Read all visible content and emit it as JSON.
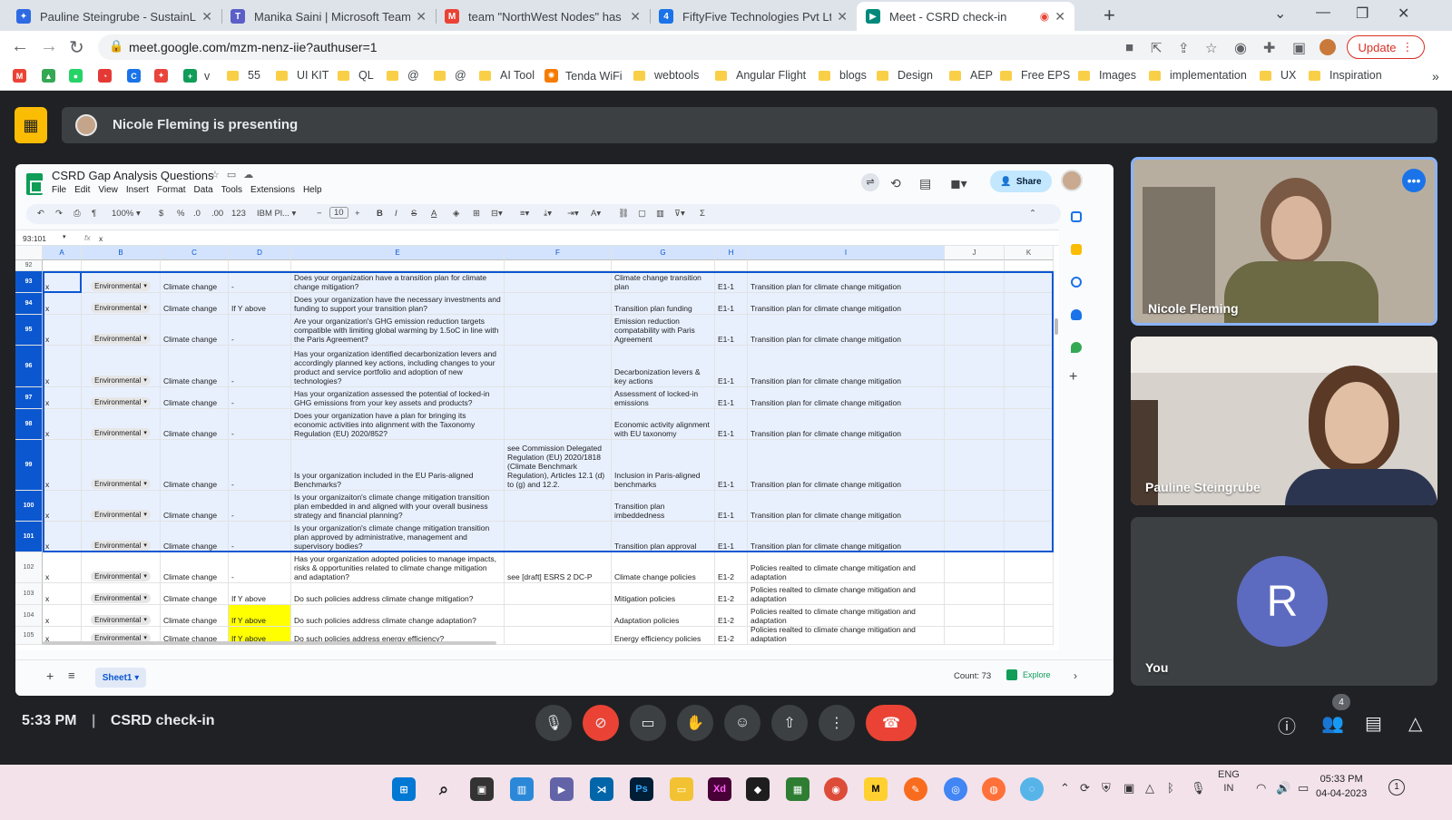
{
  "browser": {
    "tabs": [
      {
        "title": "Pauline Steingrube - SustainLab",
        "color": "#2d6ae3",
        "glyph": "✦"
      },
      {
        "title": "Manika Saini | Microsoft Teams",
        "color": "#5b5fc7",
        "glyph": "T"
      },
      {
        "title": "team \"NorthWest Nodes\" has be",
        "color": "#ea4335",
        "glyph": "M"
      },
      {
        "title": "FiftyFive Technologies Pvt Ltd - C",
        "color": "#1a73e8",
        "glyph": "4"
      },
      {
        "title": "Meet - CSRD check-in",
        "color": "#00897b",
        "glyph": "▶"
      }
    ],
    "url": "meet.google.com/mzm-nenz-iie?authuser=1",
    "update_label": "Update",
    "bookmarks": [
      {
        "label": "",
        "type": "gmail"
      },
      {
        "label": "",
        "type": "drive"
      },
      {
        "label": "",
        "type": "whatsapp"
      },
      {
        "label": "",
        "type": "speed"
      },
      {
        "label": "",
        "type": "chrome"
      },
      {
        "label": "",
        "type": "app"
      },
      {
        "label": "v",
        "type": "sheets"
      },
      {
        "label": "55",
        "type": "folder"
      },
      {
        "label": "UI KIT",
        "type": "folder"
      },
      {
        "label": "QL",
        "type": "folder"
      },
      {
        "label": "@",
        "type": "folder"
      },
      {
        "label": "@",
        "type": "folder"
      },
      {
        "label": "AI Tool",
        "type": "folder"
      },
      {
        "label": "Tenda WiFi",
        "type": "tenda"
      },
      {
        "label": "webtools",
        "type": "folder"
      },
      {
        "label": "Angular Flight",
        "type": "folder"
      },
      {
        "label": "blogs",
        "type": "folder"
      },
      {
        "label": "Design",
        "type": "folder"
      },
      {
        "label": "AEP",
        "type": "folder"
      },
      {
        "label": "Free EPS",
        "type": "folder"
      },
      {
        "label": "Images",
        "type": "folder"
      },
      {
        "label": "implementation",
        "type": "folder"
      },
      {
        "label": "UX",
        "type": "folder"
      },
      {
        "label": "Inspiration",
        "type": "folder"
      }
    ]
  },
  "meet": {
    "presenting_text": "Nicole Fleming is presenting",
    "time": "5:33 PM",
    "meeting_title": "CSRD check-in",
    "participants": [
      {
        "name": "Nicole Fleming"
      },
      {
        "name": "Pauline Steingrube"
      },
      {
        "name": "You",
        "initial": "R"
      }
    ],
    "people_count": "4"
  },
  "sheet": {
    "title": "CSRD Gap Analysis Questions",
    "menu": [
      "File",
      "Edit",
      "View",
      "Insert",
      "Format",
      "Data",
      "Tools",
      "Extensions",
      "Help"
    ],
    "share_label": "Share",
    "zoom": "100%",
    "font": "IBM Pl...",
    "font_size": "10",
    "name_box": "93:101",
    "formula_value": "x",
    "columns": [
      "A",
      "B",
      "C",
      "D",
      "E",
      "F",
      "G",
      "H",
      "I",
      "J",
      "K"
    ],
    "rows": [
      {
        "num": "92",
        "sel": false,
        "cells": [
          "",
          "",
          "",
          "",
          "",
          "",
          "",
          "",
          ""
        ]
      },
      {
        "num": "93",
        "sel": true,
        "cells": [
          "x",
          "Environmental",
          "Climate change",
          "-",
          "Does your organization have a transition plan for climate change mitigation?",
          "",
          "Climate change transition plan",
          "E1-1",
          "Transition plan for climate change mitigation"
        ]
      },
      {
        "num": "94",
        "sel": true,
        "cells": [
          "x",
          "Environmental",
          "Climate change",
          "If Y above",
          "Does your organization have the necessary investments and funding to support your transition plan?",
          "",
          "Transition plan funding",
          "E1-1",
          "Transition plan for climate change mitigation"
        ]
      },
      {
        "num": "95",
        "sel": true,
        "cells": [
          "x",
          "Environmental",
          "Climate change",
          "-",
          "Are your organization's GHG emission reduction targets compatible with limiting global warming by 1.5oC in line with the Paris Agreement?",
          "",
          "Emission reduction compatability with Paris Agreement",
          "E1-1",
          "Transition plan for climate change mitigation"
        ]
      },
      {
        "num": "96",
        "sel": true,
        "cells": [
          "x",
          "Environmental",
          "Climate change",
          "-",
          "Has your organization identified decarbonization levers and accordingly planned key actions, including changes to your product and service portfolio and adoption of new technologies?",
          "",
          "Decarbonization levers & key actions",
          "E1-1",
          "Transition plan for climate change mitigation"
        ]
      },
      {
        "num": "97",
        "sel": true,
        "cells": [
          "x",
          "Environmental",
          "Climate change",
          "-",
          "Has your organization assessed the potential of locked-in GHG emissions from your key assets and products?",
          "",
          "Assessment of locked-in emissions",
          "E1-1",
          "Transition plan for climate change mitigation"
        ]
      },
      {
        "num": "98",
        "sel": true,
        "cells": [
          "x",
          "Environmental",
          "Climate change",
          "-",
          "Does your organization have a plan for bringing its economic activities into alignment with the Taxonomy Regulation (EU) 2020/852?",
          "",
          "Economic activity alignment with EU taxonomy",
          "E1-1",
          "Transition plan for climate change mitigation"
        ]
      },
      {
        "num": "99",
        "sel": true,
        "cells": [
          "x",
          "Environmental",
          "Climate change",
          "-",
          "Is your organization included in the EU Paris-aligned Benchmarks?",
          "see Commission Delegated Regulation (EU) 2020/1818 (Climate Benchmark Regulation), Articles 12.1 (d) to (g) and 12.2.",
          "Inclusion in Paris-aligned benchmarks",
          "E1-1",
          "Transition plan for climate change mitigation"
        ]
      },
      {
        "num": "100",
        "sel": true,
        "cells": [
          "x",
          "Environmental",
          "Climate change",
          "-",
          "Is your organizaiton's climate change mitigation transition plan embedded in and aligned with your overall business strategy and financial planning?",
          "",
          "Transition plan imbeddedness",
          "E1-1",
          "Transition plan for climate change mitigation"
        ]
      },
      {
        "num": "101",
        "sel": true,
        "cells": [
          "x",
          "Environmental",
          "Climate change",
          "-",
          "Is your organization's climate change mitigation transition plan approved by administrative, management and supervisory bodies?",
          "",
          "Transition plan approval",
          "E1-1",
          "Transition plan for climate change mitigation"
        ]
      },
      {
        "num": "102",
        "sel": false,
        "cells": [
          "x",
          "Environmental",
          "Climate change",
          "-",
          "Has your organization adopted policies to manage impacts, risks & opportunities related to climate change mitigation and adaptation?",
          "see [draft] ESRS 2 DC-P",
          "Climate change policies",
          "E1-2",
          "Policies realted to climate change mitigation and adaptation"
        ]
      },
      {
        "num": "103",
        "sel": false,
        "cells": [
          "x",
          "Environmental",
          "Climate change",
          "If Y above",
          "Do such policies address climate change mitigation?",
          "",
          "Mitigation policies",
          "E1-2",
          "Policies realted to climate change mitigation and adaptation"
        ]
      },
      {
        "num": "104",
        "sel": false,
        "cells": [
          "x",
          "Environmental",
          "Climate change",
          "If Y above",
          "Do such policies address climate change adaptation?",
          "",
          "Adaptation policies",
          "E1-2",
          "Policies realted to climate change mitigation and adaptation"
        ]
      },
      {
        "num": "105",
        "sel": false,
        "cells": [
          "x",
          "Environmental",
          "Climate change",
          "If Y above",
          "Do such policies address energy efficiency?",
          "",
          "Energy efficiency policies",
          "E1-2",
          "Policies realted to climate change mitigation and adaptation"
        ]
      }
    ],
    "sheet_tab": "Sheet1",
    "count_label": "Count: 73",
    "explore_label": "Explore"
  },
  "taskbar": {
    "lang": "ENG",
    "lang_sub": "IN",
    "time": "05:33 PM",
    "date": "04-04-2023",
    "notif": "1"
  }
}
